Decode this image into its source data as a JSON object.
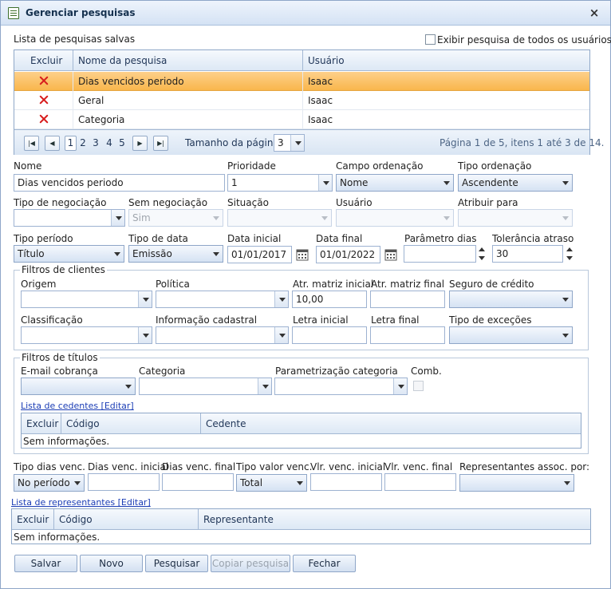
{
  "window": {
    "title": "Gerenciar pesquisas",
    "close_glyph": "×"
  },
  "saved": {
    "label": "Lista de pesquisas salvas",
    "show_all_label": "Exibir pesquisa de todos os usuários",
    "columns": [
      "Excluir",
      "Nome da pesquisa",
      "Usuário"
    ],
    "rows": [
      {
        "name": "Dias vencidos periodo",
        "user": "Isaac",
        "selected": true
      },
      {
        "name": "Geral",
        "user": "Isaac"
      },
      {
        "name": "Categoria",
        "user": "Isaac"
      }
    ],
    "pager": {
      "pages": [
        "1",
        "2",
        "3",
        "4",
        "5"
      ],
      "page_size_label": "Tamanho da página:",
      "page_size": "3",
      "summary": "Página 1 de 5, itens 1 até 3 de 14."
    }
  },
  "form": {
    "nome": {
      "label": "Nome",
      "value": "Dias vencidos periodo"
    },
    "prioridade": {
      "label": "Prioridade",
      "value": "1"
    },
    "campo_ordenacao": {
      "label": "Campo ordenação",
      "value": "Nome"
    },
    "tipo_ordenacao": {
      "label": "Tipo ordenação",
      "value": "Ascendente"
    },
    "tipo_negociacao": {
      "label": "Tipo de negociação",
      "value": ""
    },
    "sem_negociacao": {
      "label": "Sem negociação",
      "value": "Sim"
    },
    "situacao": {
      "label": "Situação",
      "value": ""
    },
    "usuario": {
      "label": "Usuário",
      "value": ""
    },
    "atribuir_para": {
      "label": "Atribuir para",
      "value": ""
    },
    "tipo_periodo": {
      "label": "Tipo período",
      "value": "Título"
    },
    "tipo_data": {
      "label": "Tipo de data",
      "value": "Emissão"
    },
    "data_inicial": {
      "label": "Data inicial",
      "value": "01/01/2017"
    },
    "data_final": {
      "label": "Data final",
      "value": "01/01/2022"
    },
    "parametro_dias": {
      "label": "Parâmetro dias",
      "value": ""
    },
    "tolerancia_atraso": {
      "label": "Tolerância atraso",
      "value": "30"
    }
  },
  "clientes": {
    "legend": "Filtros de clientes",
    "origem": "Origem",
    "politica": "Política",
    "atr_matriz_inicial": {
      "label": "Atr. matriz inicial",
      "value": "10,00"
    },
    "atr_matriz_final": {
      "label": "Atr. matriz final",
      "value": ""
    },
    "seguro_credito": "Seguro de crédito",
    "classificacao": "Classificação",
    "info_cadastral": "Informação cadastral",
    "letra_inicial": "Letra inicial",
    "letra_final": "Letra final",
    "tipo_excecoes": "Tipo de exceções"
  },
  "titulos": {
    "legend": "Filtros de títulos",
    "email_cobranca": "E-mail cobrança",
    "categoria": "Categoria",
    "param_categoria": "Parametrização categoria",
    "comb": "Comb.",
    "cedentes_link": "Lista de cedentes [Editar]",
    "cedentes_columns": [
      "Excluir",
      "Código",
      "Cedente"
    ],
    "no_info": "Sem informações."
  },
  "vencimento": {
    "tipo_dias_venc": {
      "label": "Tipo dias venc.",
      "value": "No período"
    },
    "dias_venc_inicial": "Dias venc. inicial",
    "dias_venc_final": "Dias venc. final",
    "tipo_valor_venc": {
      "label": "Tipo valor venc.",
      "value": "Total"
    },
    "vlr_venc_inicial": "Vlr. venc. inicial",
    "vlr_venc_final": "Vlr. venc. final",
    "representantes_assoc": "Representantes assoc. por:"
  },
  "representantes": {
    "link": "Lista de representantes [Editar]",
    "columns": [
      "Excluir",
      "Código",
      "Representante"
    ],
    "no_info": "Sem informações."
  },
  "buttons": {
    "salvar": "Salvar",
    "novo": "Novo",
    "pesquisar": "Pesquisar",
    "copiar": "Copiar pesquisa",
    "fechar": "Fechar"
  },
  "colors": {
    "selected_row": "#f9b64c",
    "header_bg": "#dde8f5",
    "link": "#1b3db5"
  }
}
